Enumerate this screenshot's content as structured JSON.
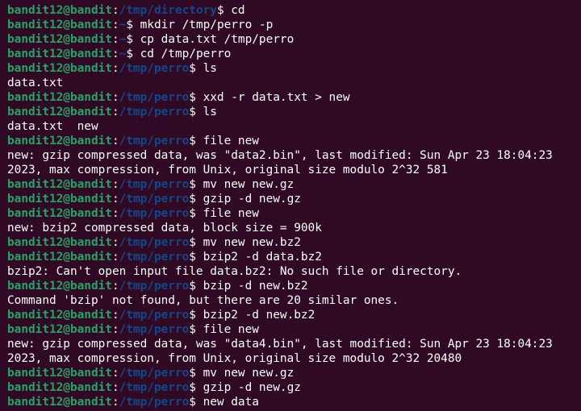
{
  "prompt_user_host": "bandit12@bandit",
  "lines": [
    {
      "type": "prompt",
      "cwd": "/tmp/directory",
      "cmd": "cd"
    },
    {
      "type": "prompt",
      "cwd": "~",
      "cmd": "mkdir /tmp/perro -p"
    },
    {
      "type": "prompt",
      "cwd": "~",
      "cmd": "cp data.txt /tmp/perro"
    },
    {
      "type": "prompt",
      "cwd": "~",
      "cmd": "cd /tmp/perro"
    },
    {
      "type": "prompt",
      "cwd": "/tmp/perro",
      "cmd": "ls"
    },
    {
      "type": "output",
      "text": "data.txt"
    },
    {
      "type": "prompt",
      "cwd": "/tmp/perro",
      "cmd": "xxd -r data.txt > new"
    },
    {
      "type": "prompt",
      "cwd": "/tmp/perro",
      "cmd": "ls"
    },
    {
      "type": "output",
      "text": "data.txt  new"
    },
    {
      "type": "prompt",
      "cwd": "/tmp/perro",
      "cmd": "file new"
    },
    {
      "type": "output",
      "text": "new: gzip compressed data, was \"data2.bin\", last modified: Sun Apr 23 18:04:23"
    },
    {
      "type": "output",
      "text": "2023, max compression, from Unix, original size modulo 2^32 581"
    },
    {
      "type": "prompt",
      "cwd": "/tmp/perro",
      "cmd": "mv new new.gz"
    },
    {
      "type": "prompt",
      "cwd": "/tmp/perro",
      "cmd": "gzip -d new.gz"
    },
    {
      "type": "prompt",
      "cwd": "/tmp/perro",
      "cmd": "file new"
    },
    {
      "type": "output",
      "text": "new: bzip2 compressed data, block size = 900k"
    },
    {
      "type": "prompt",
      "cwd": "/tmp/perro",
      "cmd": "mv new new.bz2"
    },
    {
      "type": "prompt",
      "cwd": "/tmp/perro",
      "cmd": "bzip2 -d data.bz2"
    },
    {
      "type": "output",
      "text": "bzip2: Can't open input file data.bz2: No such file or directory."
    },
    {
      "type": "prompt",
      "cwd": "/tmp/perro",
      "cmd": "bzip -d new.bz2"
    },
    {
      "type": "output",
      "text": "Command 'bzip' not found, but there are 20 similar ones."
    },
    {
      "type": "prompt",
      "cwd": "/tmp/perro",
      "cmd": "bzip2 -d new.bz2"
    },
    {
      "type": "prompt",
      "cwd": "/tmp/perro",
      "cmd": "file new"
    },
    {
      "type": "output",
      "text": "new: gzip compressed data, was \"data4.bin\", last modified: Sun Apr 23 18:04:23"
    },
    {
      "type": "output",
      "text": "2023, max compression, from Unix, original size modulo 2^32 20480"
    },
    {
      "type": "prompt",
      "cwd": "/tmp/perro",
      "cmd": "mv new new.gz"
    },
    {
      "type": "prompt",
      "cwd": "/tmp/perro",
      "cmd": "gzip -d new.gz"
    },
    {
      "type": "prompt",
      "cwd": "/tmp/perro",
      "cmd": "new data"
    }
  ]
}
